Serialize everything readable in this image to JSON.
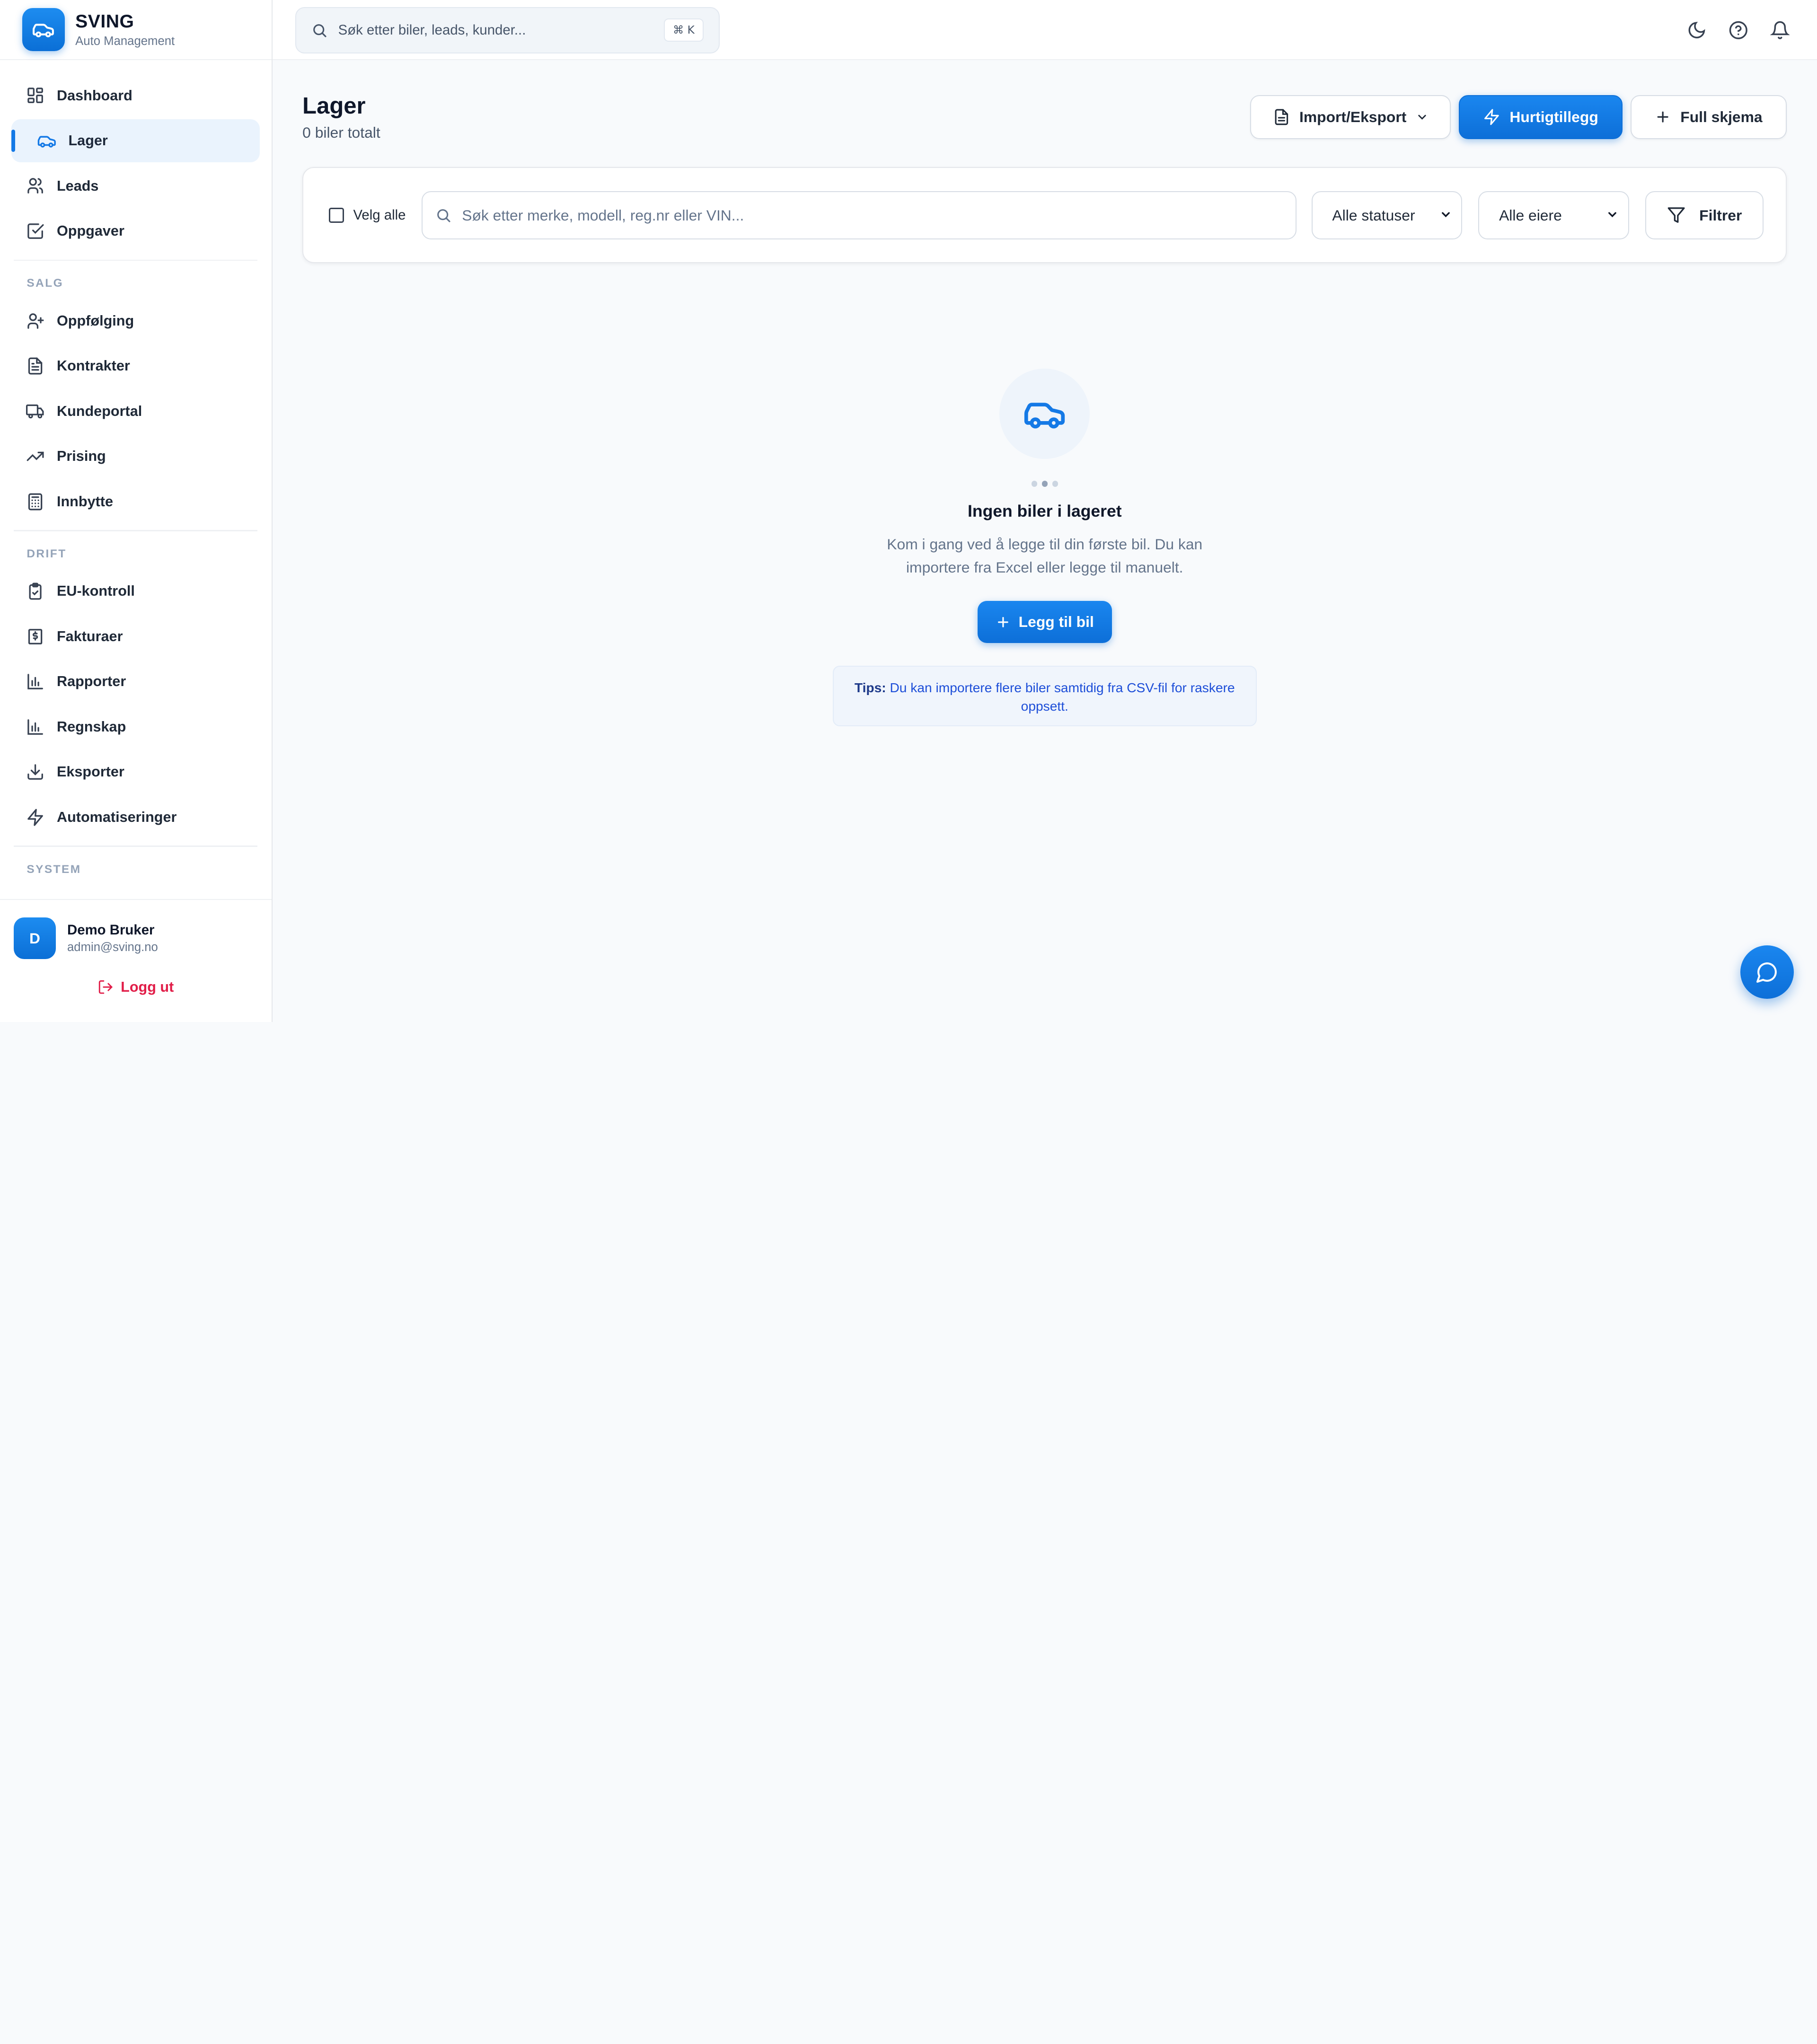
{
  "brand": {
    "name": "SVING",
    "subtitle": "Auto Management"
  },
  "topbar": {
    "search_placeholder": "Søk etter biler, leads, kunder...",
    "shortcut": "⌘ K"
  },
  "nav": {
    "main": [
      {
        "label": "Dashboard",
        "icon": "dashboard-icon"
      },
      {
        "label": "Lager",
        "icon": "car-icon",
        "active": true
      },
      {
        "label": "Leads",
        "icon": "users-icon"
      },
      {
        "label": "Oppgaver",
        "icon": "checkbox-icon"
      }
    ],
    "sections": [
      {
        "title": "SALG",
        "items": [
          {
            "label": "Oppfølging",
            "icon": "user-plus-icon"
          },
          {
            "label": "Kontrakter",
            "icon": "file-text-icon"
          },
          {
            "label": "Kundeportal",
            "icon": "truck-icon"
          },
          {
            "label": "Prising",
            "icon": "trending-up-icon"
          },
          {
            "label": "Innbytte",
            "icon": "calculator-icon"
          }
        ]
      },
      {
        "title": "DRIFT",
        "items": [
          {
            "label": "EU-kontroll",
            "icon": "clipboard-check-icon"
          },
          {
            "label": "Fakturaer",
            "icon": "invoice-icon"
          },
          {
            "label": "Rapporter",
            "icon": "bar-chart-icon"
          },
          {
            "label": "Regnskap",
            "icon": "bar-chart-icon"
          },
          {
            "label": "Eksporter",
            "icon": "download-icon"
          },
          {
            "label": "Automatiseringer",
            "icon": "zap-icon"
          }
        ]
      },
      {
        "title": "SYSTEM",
        "items": []
      }
    ]
  },
  "user": {
    "initial": "D",
    "name": "Demo Bruker",
    "email": "admin@sving.no",
    "logout_label": "Logg ut"
  },
  "page": {
    "title": "Lager",
    "subtitle": "0 biler totalt",
    "import_export_label": "Import/Eksport",
    "quick_add_label": "Hurtigtillegg",
    "full_form_label": "Full skjema"
  },
  "filters": {
    "select_all_label": "Velg alle",
    "search_placeholder": "Søk etter merke, modell, reg.nr eller VIN...",
    "status_select": "Alle statuser",
    "owner_select": "Alle eiere",
    "filter_button": "Filtrer"
  },
  "empty_state": {
    "title": "Ingen biler i lageret",
    "description": "Kom i gang ved å legge til din første bil. Du kan importere fra Excel eller legge til manuelt.",
    "add_button": "Legg til bil",
    "tip_label": "Tips:",
    "tip_text": " Du kan importere flere biler samtidig fra CSV-fil for raskere oppsett."
  },
  "colors": {
    "accent": "#1479e6",
    "danger": "#e11d48",
    "background": "#f8fafc"
  }
}
